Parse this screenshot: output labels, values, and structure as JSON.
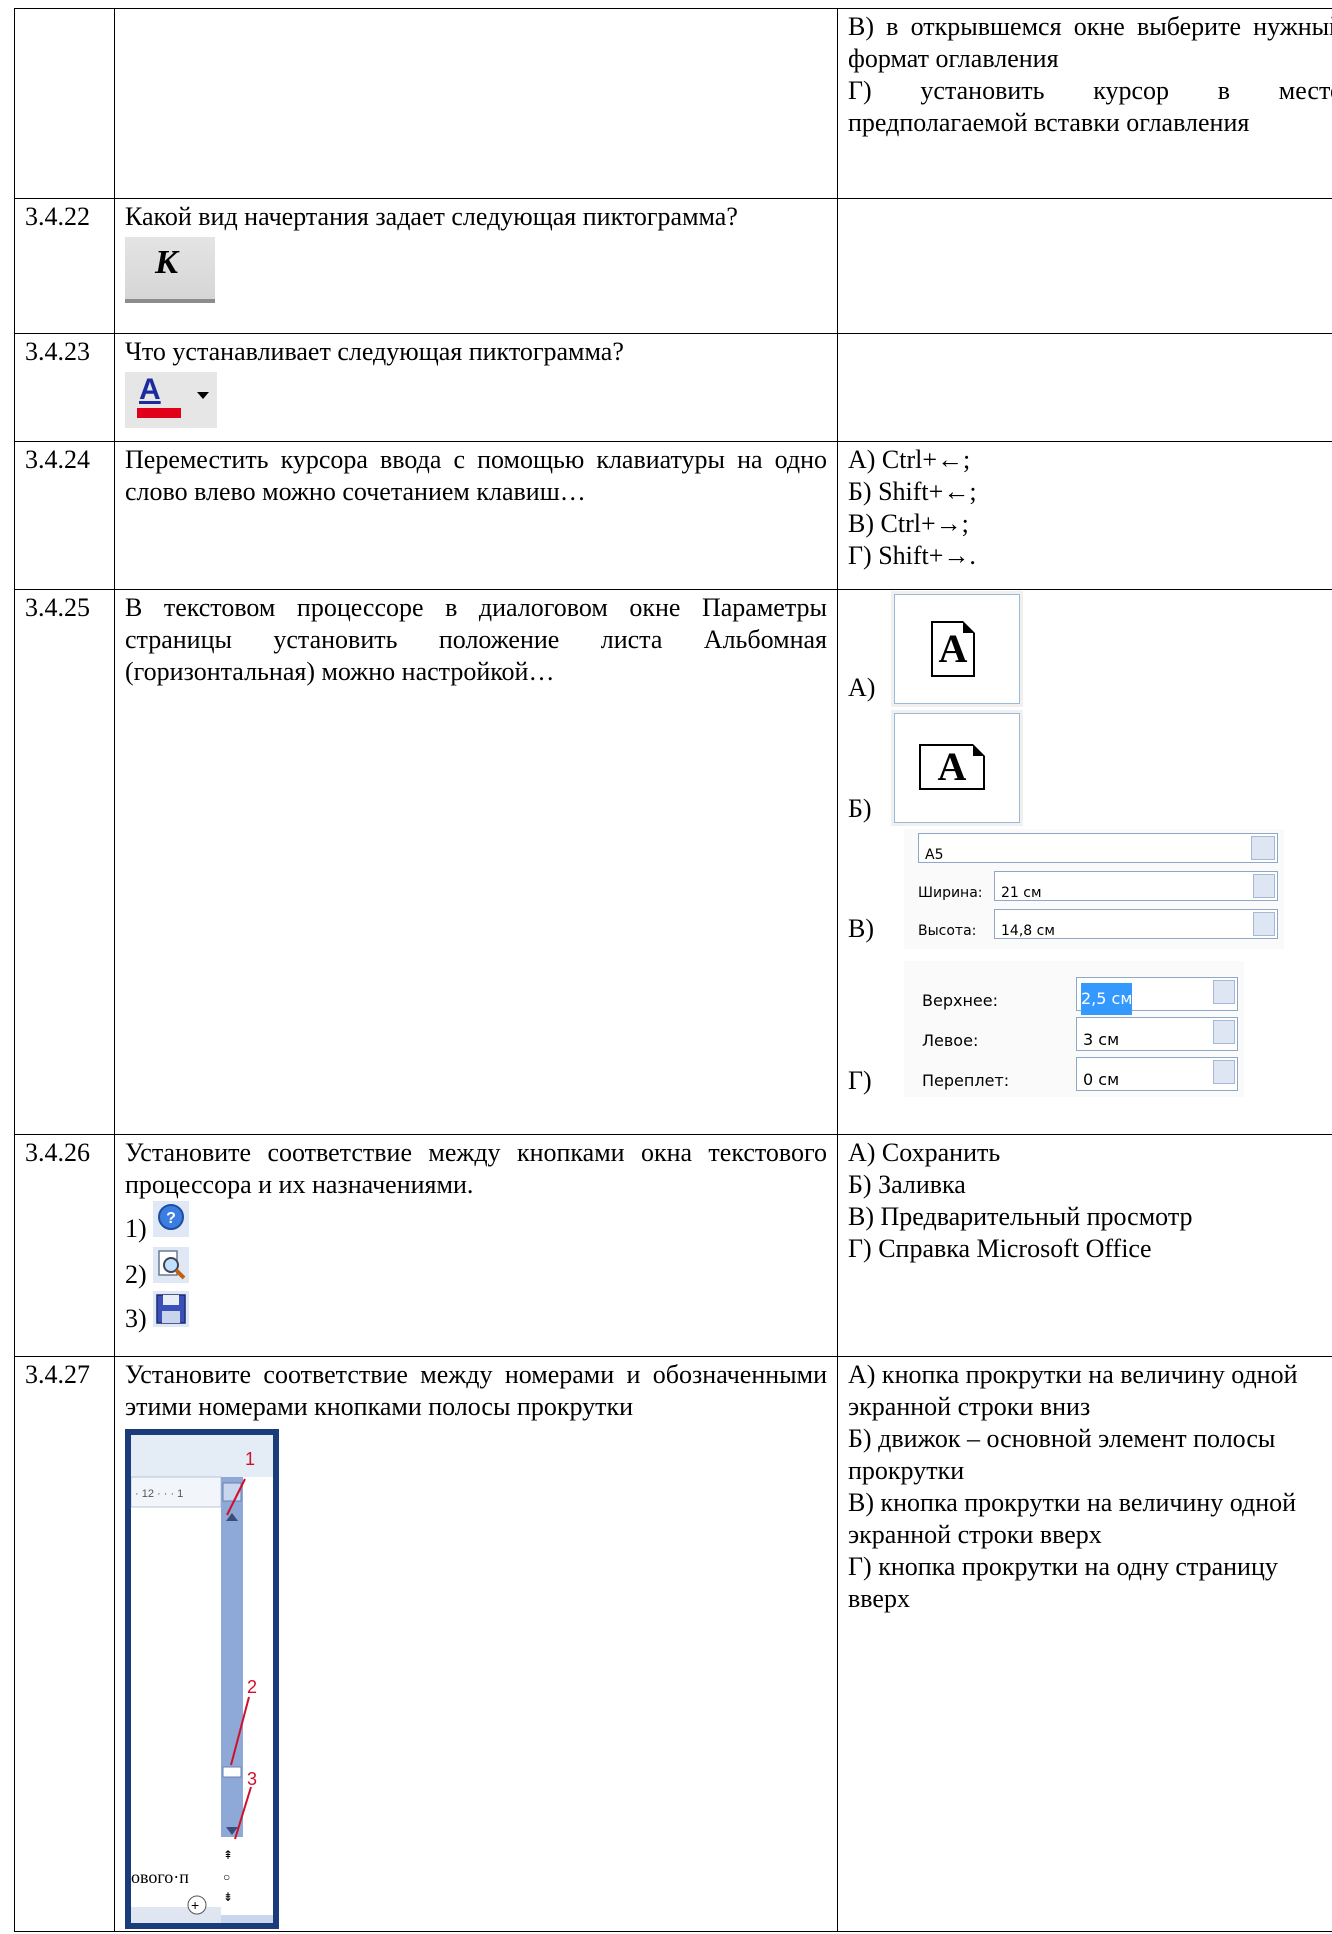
{
  "rows": [
    {
      "num": "",
      "question": [],
      "answers": [
        "В) в открывшемся окне выберите нужный формат оглавления",
        "Г) установить курсор в место предполагаемой вставки оглавления"
      ]
    },
    {
      "num": "3.4.22",
      "question": [
        "Какой вид начертания задает следующая пиктограмма?"
      ],
      "icon_letter": "К",
      "answers": []
    },
    {
      "num": "3.4.23",
      "question": [
        "Что устанавливает следующая пиктограмма?"
      ],
      "icon_letter": "A",
      "answers": []
    },
    {
      "num": "3.4.24",
      "question": [
        "Переместить курсора ввода с помощью клавиатуры на одно слово влево можно сочетанием клавиш…"
      ],
      "answers": [
        "А) Ctrl+←;",
        "Б) Shift+←;",
        "В) Ctrl+→;",
        "Г) Shift+→."
      ]
    },
    {
      "num": "3.4.25",
      "question": [
        "В текстовом процессоре в диалоговом окне Параметры страницы установить положение листа Альбомная (горизонтальная) можно настройкой…"
      ],
      "answers": [
        "А)",
        "Б)",
        "В)",
        "Г)"
      ],
      "page_letter": "A",
      "paper": {
        "size": "A5",
        "width_label": "Ширина:",
        "width_value": "21 см",
        "height_label": "Высота:",
        "height_value": "14,8 см"
      },
      "margins": {
        "top_label": "Верхнее:",
        "top_value": "2,5 см",
        "left_label": "Левое:",
        "left_value": "3 см",
        "gutter_label": "Переплет:",
        "gutter_value": "0 см"
      }
    },
    {
      "num": "3.4.26",
      "question": [
        "Установите соответствие между кнопками окна текстового процессора и их назначениями."
      ],
      "items": [
        "1)",
        "2)",
        "3)"
      ],
      "answers": [
        "А) Сохранить",
        "Б) Заливка",
        "В) Предварительный просмотр",
        "Г) Справка Microsoft Office"
      ]
    },
    {
      "num": "3.4.27",
      "question": [
        "Установите соответствие между номерами и обозначенными этими номерами кнопками полосы прокрутки"
      ],
      "figure": {
        "ruler_text": "· 12 · · · 1",
        "doc_text": "ового·п",
        "callouts": [
          "1",
          "2",
          "3"
        ]
      },
      "answers": [
        "А)  кнопка прокрутки на величину одной экранной строки вниз",
        "Б) движок – основной элемент полосы прокрутки",
        "В) кнопка прокрутки на величину одной экранной строки вверх",
        "Г) кнопка прокрутки на одну страницу вверх"
      ]
    }
  ],
  "colors": {
    "border": "#000000",
    "scrollbar_frame": "#1a3c7a",
    "callout": "#d0102a"
  }
}
